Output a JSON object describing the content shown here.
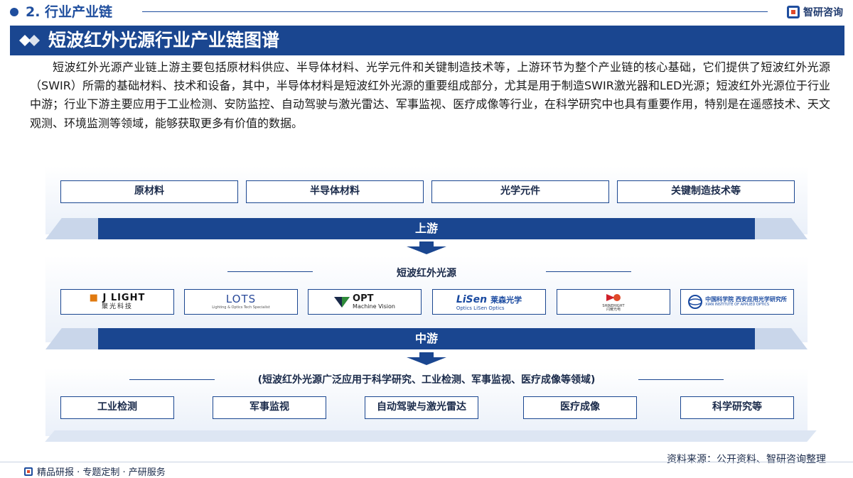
{
  "section": {
    "title": "2. 行业产业链"
  },
  "brand": {
    "name": "智研咨询"
  },
  "banner": {
    "title": "短波红外光源行业产业链图谱"
  },
  "intro": "短波红外光源产业链上游主要包括原材料供应、半导体材料、光学元件和关键制造技术等，上游环节为整个产业链的核心基础，它们提供了短波红外光源（SWIR）所需的基础材料、技术和设备，其中，半导体材料是短波红外光源的重要组成部分，尤其是用于制造SWIR激光器和LED光源；短波红外光源位于行业中游；行业下游主要应用于工业检测、安防监控、自动驾驶与激光雷达、军事监视、医疗成像等行业，在科学研究中也具有重要作用，特别是在遥感技术、天文观测、环境监测等领域，能够获取更多有价值的数据。",
  "upstream": {
    "items": [
      "原材料",
      "半导体材料",
      "光学元件",
      "关键制造技术等"
    ],
    "bar_label": "上游"
  },
  "midstream": {
    "title": "短波红外光源",
    "bar_label": "中游",
    "logos": [
      {
        "name": "J LIGHT",
        "sub": "聚光科技"
      },
      {
        "name": "LOTS",
        "sub": "Lighting & Optics Tech Specialist"
      },
      {
        "name": "OPT",
        "sub": "Machine Vision"
      },
      {
        "name": "LiSen",
        "sub": "莱森光学",
        "sub2": "Optics  LiSen Optics"
      },
      {
        "name": "SHINEHIGHT",
        "sub": "闪耀光电"
      },
      {
        "name": "中国科学院 西安应用光学研究所",
        "sub": "XIAN INSTITUTE OF APPLIED OPTICS"
      }
    ]
  },
  "downstream": {
    "title": "(短波红外光源广泛应用于科学研究、工业检测、军事监视、医疗成像等领域)",
    "items": [
      "工业检测",
      "军事监视",
      "自动驾驶与激光雷达",
      "医疗成像",
      "科学研究等"
    ]
  },
  "source": "资料来源：公开资料、智研咨询整理",
  "footer": "精品研报 · 专题定制 · 产研服务",
  "colors": {
    "primary": "#1a4690",
    "accent": "#e04a2a",
    "panel": "#eaf0f9"
  }
}
